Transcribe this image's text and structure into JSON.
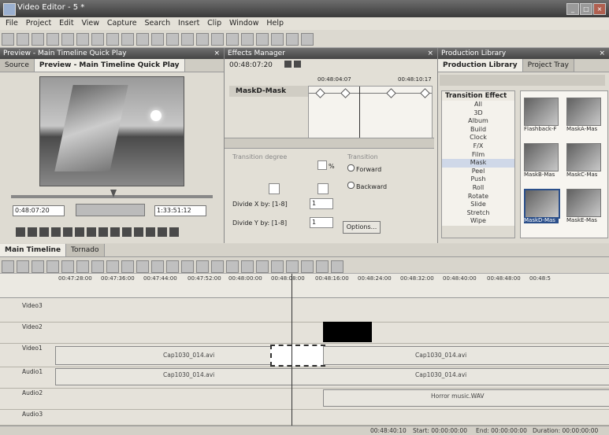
{
  "window": {
    "title": "Video Editor - 5 *"
  },
  "menu": [
    "File",
    "Project",
    "Edit",
    "View",
    "Capture",
    "Search",
    "Insert",
    "Clip",
    "Window",
    "Help"
  ],
  "preview": {
    "panel_title": "Preview - Main Timeline Quick Play",
    "tabs": [
      "Source",
      "Preview - Main Timeline Quick Play"
    ],
    "timecode_left": "0:48:07:20",
    "timecode_right": "1:33:51:12"
  },
  "effects": {
    "panel_title": "Effects Manager",
    "timecode": "00:48:07:20",
    "ruler_left": "00:48:04:07",
    "ruler_right": "00:48:10:17",
    "effect_name": "MaskD-Mask",
    "transition_degree_label": "Transition degree",
    "transition_degree_unit": "%",
    "transition_label": "Transition",
    "forward_label": "Forward",
    "backward_label": "Backward",
    "divide_x_label": "Divide X by: [1-8]",
    "divide_x_value": "1",
    "divide_y_label": "Divide Y by: [1-8]",
    "divide_y_value": "1",
    "options_label": "Options..."
  },
  "library": {
    "panel_title": "Production Library",
    "tabs": [
      "Production Library",
      "Project Tray"
    ],
    "category_title": "Transition Effect",
    "categories": [
      "All",
      "3D",
      "Album",
      "Build",
      "Clock",
      "F/X",
      "Film",
      "Mask",
      "Peel",
      "Push",
      "Roll",
      "Rotate",
      "Slide",
      "Stretch",
      "Wipe"
    ],
    "selected_category": "Mask",
    "thumbs": [
      "Flashback-F",
      "MaskA-Mas",
      "MaskB-Mas",
      "MaskC-Mas",
      "MaskD-Mas",
      "MaskE-Mas"
    ]
  },
  "timeline": {
    "tabs": [
      "Main Timeline",
      "Tornado"
    ],
    "ruler": [
      "00:47:28:00",
      "00:47:36:00",
      "00:47:44:00",
      "00:47:52:00",
      "00:48:00:00",
      "00:48:08:00",
      "00:48:16:00",
      "00:48:24:00",
      "00:48:32:00",
      "00:48:40:00",
      "00:48:48:00",
      "00:48:5"
    ],
    "tracks": [
      "Video3",
      "Video2",
      "Video1",
      "Audio1",
      "Audio2",
      "Audio3"
    ],
    "clip_video1_left": "Cap1030_014.avi",
    "clip_video1_right": "Cap1030_014.avi",
    "clip_audio1_left": "Cap1030_014.avi",
    "clip_audio1_right": "Cap1030_014.avi",
    "clip_audio2": "Horror music.WAV"
  },
  "status": {
    "time": "00:48:40:10",
    "start": "Start: 00:00:00:00",
    "end": "End: 00:00:00:00",
    "duration": "Duration: 00:00:00:00"
  }
}
